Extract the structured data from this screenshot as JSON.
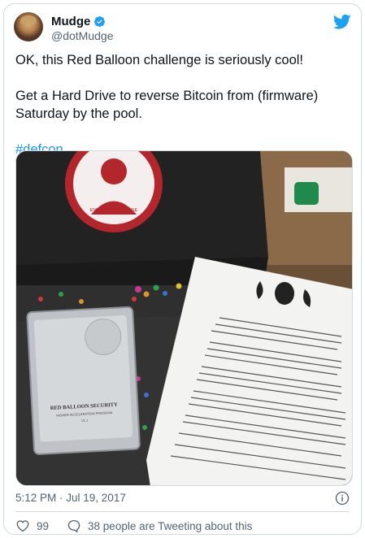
{
  "tweet": {
    "display_name": "Mudge",
    "handle": "@dotMudge",
    "lines": [
      "OK, this Red Balloon challenge is seriously cool!",
      "Get a Hard Drive to reverse Bitcoin from (firmware)",
      "Saturday by the pool."
    ],
    "hashtag": "#defcon",
    "timestamp": "5:12 PM · Jul 19, 2017",
    "likes": "99",
    "tweeting_about": "38 people are Tweeting about this"
  },
  "media": {
    "sticker_text": "EMBEDDED DEFENSE",
    "drive_label_line1": "RED BALLOON SECURITY",
    "drive_label_line2": "HIGHER ACCELERATION PROGRAM",
    "drive_label_line3": "V1.1"
  },
  "colors": {
    "accent": "#1b95e0",
    "verified": "#1da1f2",
    "secondary_text": "#536471",
    "border": "#cfd9de",
    "sticker_red": "#b3262b"
  },
  "icons": {
    "verified": "verified-badge-icon",
    "twitter": "twitter-bird-icon",
    "info": "info-icon",
    "like": "heart-icon",
    "reply": "speech-bubble-icon"
  }
}
